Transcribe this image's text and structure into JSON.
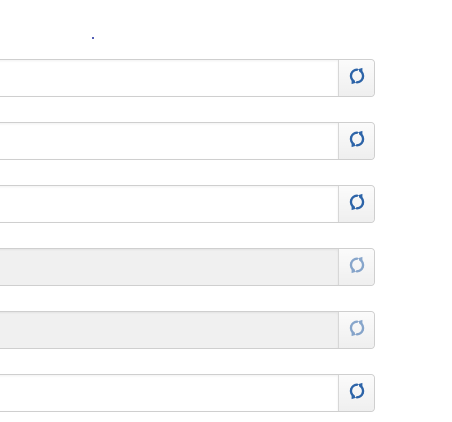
{
  "page": {
    "rows": [
      {
        "state": "enabled",
        "icon": "refresh-icon"
      },
      {
        "state": "enabled",
        "icon": "refresh-icon"
      },
      {
        "state": "enabled",
        "icon": "refresh-icon"
      },
      {
        "state": "disabled",
        "icon": "refresh-icon"
      },
      {
        "state": "disabled",
        "icon": "refresh-icon"
      },
      {
        "state": "enabled",
        "icon": "refresh-icon"
      }
    ]
  },
  "colors": {
    "icon": "#2d64a8",
    "border": "#cfcfcf",
    "disabled_bg": "#f0f0f0",
    "addon_bg": "#f4f4f4",
    "dot": "#1d2a9e"
  }
}
